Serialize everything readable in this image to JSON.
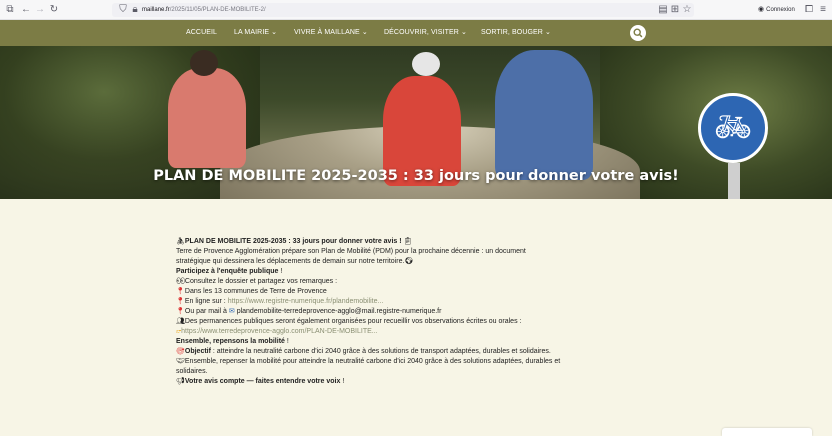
{
  "browser": {
    "url_host": "maillane.fr",
    "url_path": "/2025/11/05/PLAN-DE-MOBILITE-2/",
    "connexion_label": "Connexion",
    "icons": [
      "firefox-view-icon",
      "back-icon",
      "forward-icon",
      "reload-icon",
      "shield-icon",
      "lock-icon",
      "reader-view-icon",
      "translate-icon",
      "bookmark-star-icon",
      "account-icon",
      "extensions-icon",
      "menu-icon"
    ]
  },
  "nav": {
    "items": [
      {
        "label": "ACCUEIL"
      },
      {
        "label": "LA MAIRIE ⌄"
      },
      {
        "label": "VIVRE À MAILLANE ⌄"
      },
      {
        "label": "DÉCOUVRIR, VISITER ⌄"
      },
      {
        "label": "SORTIR, BOUGER ⌄"
      }
    ],
    "background": "#7c7c45"
  },
  "hero": {
    "title": "PLAN DE MOBILITE 2025-2035 : 33 jours pour donner votre avis!"
  },
  "article": {
    "heading_bold": "PLAN DE MOBILITE 2025-2035 : 33 jours pour donner votre avis !",
    "intro_line1": "Terre de Provence Agglomération prépare son Plan de Mobilité (PDM) pour la prochaine décennie : un document",
    "intro_line2": "stratégique qui dessinera les déplacements de demain sur notre territoire.",
    "participate": "Participez à l'enquête publique",
    "participate_suffix": " !",
    "consult": "Consultez le dossier et partagez vos remarques :",
    "communes": "Dans les 13 communes de Terre de Provence",
    "online_prefix": "En ligne sur : ",
    "online_link": "https://www.registre-numerique.fr/plandemobilite...",
    "mail_prefix": "Ou par mail à ",
    "mail_address": "plandemobilite-terredeprovence-agglo@mail.registre-numerique.fr",
    "permanences": "Des permanences publiques seront également organisées pour recueillir vos observations écrites ou orales :",
    "agglo_link": "https://www.terredeprovence-agglo.com/PLAN-DE-MOBILITE...",
    "together_bold": "Ensemble, repensons la mobilité",
    "together_suffix": " !",
    "objective_bold": "Objectif",
    "objective_text": " : atteindre la neutralité carbone d'ici 2040 grâce à des solutions de transport adaptées, durables et solidaires.",
    "ensemble_line1": "Ensemble, repenser la mobilité pour atteindre la neutralité carbone d'ici 2040 grâce à des solutions adaptées, durables et",
    "ensemble_line2": "solidaires.",
    "voice_bold": "Votre avis compte — faites entendre votre voix",
    "voice_suffix": " !"
  }
}
